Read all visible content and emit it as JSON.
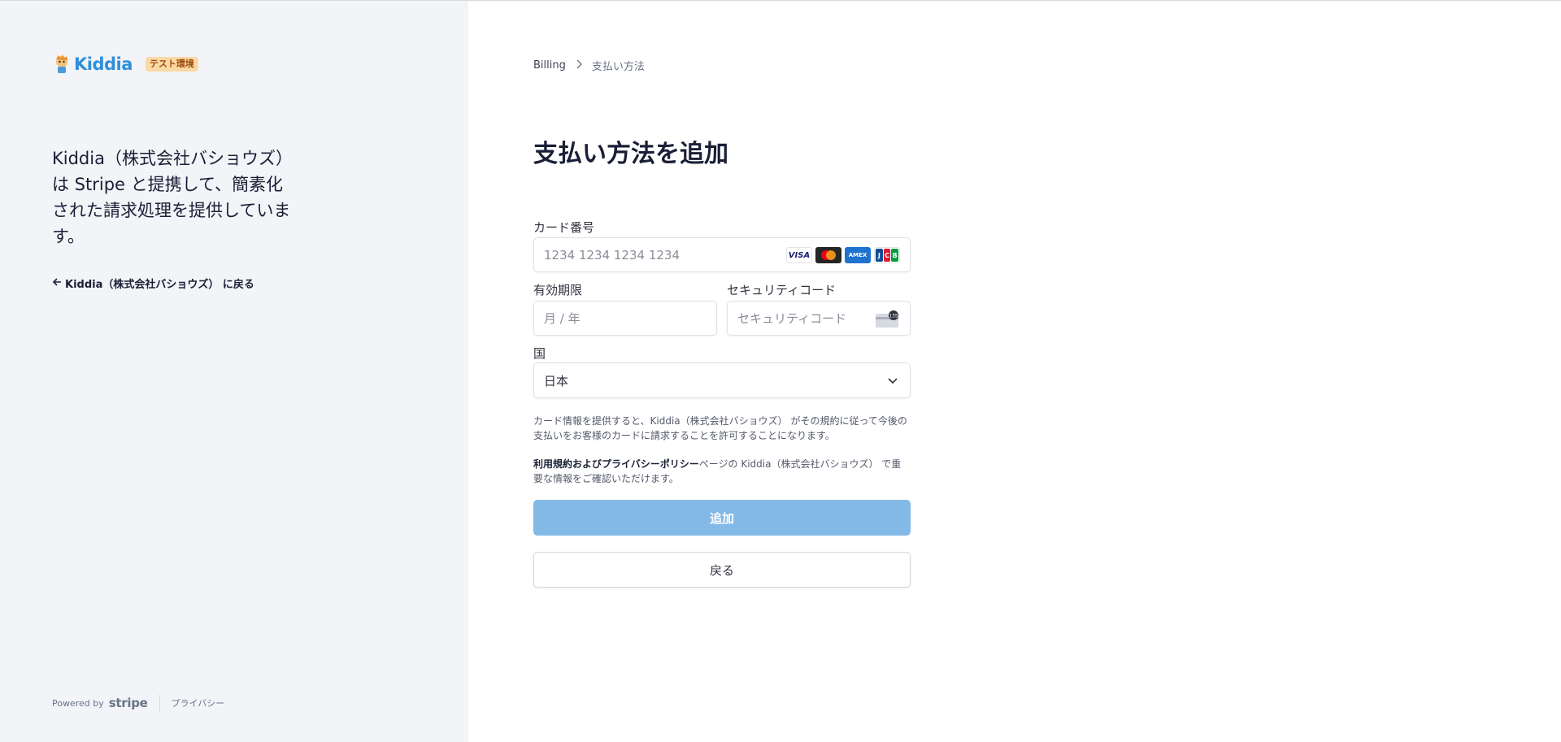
{
  "merchant": {
    "name": "Kiddia",
    "env_badge": "テスト環境",
    "tagline": "Kiddia（株式会社バショウズ） は Stripe と提携して、簡素化された請求処理を提供しています。",
    "back_link": "Kiddia（株式会社バショウズ） に戻る"
  },
  "footer": {
    "powered_by": "Powered by",
    "stripe": "stripe",
    "privacy": "プライバシー"
  },
  "breadcrumb": {
    "parent": "Billing",
    "separator": ">",
    "current": "支払い方法"
  },
  "page_title": "支払い方法を追加",
  "form": {
    "card_number": {
      "label": "カード番号",
      "placeholder": "1234 1234 1234 1234",
      "brands": [
        "VISA",
        "Mastercard",
        "AMEX",
        "JCB"
      ]
    },
    "expiry": {
      "label": "有効期限",
      "placeholder": "月 / 年"
    },
    "cvc": {
      "label": "セキュリティコード",
      "placeholder": "セキュリティコード",
      "icon_digits": "135"
    },
    "country": {
      "label": "国",
      "value": "日本"
    }
  },
  "notices": {
    "authorization": "カード情報を提供すると、Kiddia（株式会社バショウズ） がその規約に従って今後の支払いをお客様のカードに請求することを許可することになります。",
    "terms_bold": "利用規約およびプライバシーポリシー",
    "terms_rest": "ページの Kiddia（株式会社バショウズ） で重要な情報をご確認いただけます。"
  },
  "buttons": {
    "add": "追加",
    "back": "戻る"
  },
  "colors": {
    "left_bg": "#f3f4f8",
    "primary_button": "#82b9e6",
    "badge_bg": "#fbd9a5",
    "brand": "#2f8fd8"
  }
}
